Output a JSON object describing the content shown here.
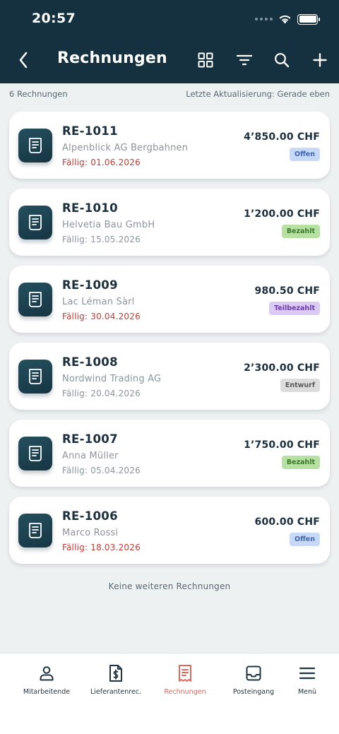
{
  "status_bar": {
    "time": "20:57"
  },
  "header": {
    "title": "Rechnungen"
  },
  "summary": {
    "count": "6 Rechnungen",
    "last_update": "Letzte Aktualisierung: Gerade eben"
  },
  "invoices": [
    {
      "number": "RE-1011",
      "customer": "Alpenblick AG Bergbahnen",
      "due": "Fällig: 01.06.2026",
      "overdue": true,
      "amount": "4’850.00 CHF",
      "status": "Offen"
    },
    {
      "number": "RE-1010",
      "customer": "Helvetia Bau GmbH",
      "due": "Fällig: 15.05.2026",
      "overdue": false,
      "amount": "1’200.00 CHF",
      "status": "Bezahlt"
    },
    {
      "number": "RE-1009",
      "customer": "Lac Léman Sàrl",
      "due": "Fällig: 30.04.2026",
      "overdue": true,
      "amount": "980.50 CHF",
      "status": "Teilbezahlt"
    },
    {
      "number": "RE-1008",
      "customer": "Nordwind Trading AG",
      "due": "Fällig: 20.04.2026",
      "overdue": false,
      "amount": "2’300.00 CHF",
      "status": "Entwurf"
    },
    {
      "number": "RE-1007",
      "customer": "Anna Müller",
      "due": "Fällig: 05.04.2026",
      "overdue": false,
      "amount": "1’750.00 CHF",
      "status": "Bezahlt"
    },
    {
      "number": "RE-1006",
      "customer": "Marco Rossi",
      "due": "Fällig: 18.03.2026",
      "overdue": true,
      "amount": "600.00 CHF",
      "status": "Offen"
    }
  ],
  "list_end": "Keine weiteren Rechnungen",
  "tabs": [
    {
      "label": "Mitarbeitende",
      "icon": "person-icon",
      "active": false
    },
    {
      "label": "Lieferantenrec.",
      "icon": "dollar-document-icon",
      "active": false
    },
    {
      "label": "Rechnungen",
      "icon": "receipt-icon",
      "active": true
    },
    {
      "label": "Posteingang",
      "icon": "inbox-icon",
      "active": false
    },
    {
      "label": "Menü",
      "icon": "hamburger-menu-icon",
      "active": false
    }
  ],
  "colors": {
    "header_bg": "#15303f",
    "overdue": "#c93a35",
    "active_tab": "#e4675b",
    "badge_offen": "#c7d9f6",
    "badge_bezahlt": "#b7e0a3",
    "badge_teilbezahlt": "#dbcaf3",
    "badge_entwurf": "#dcdcdc"
  }
}
